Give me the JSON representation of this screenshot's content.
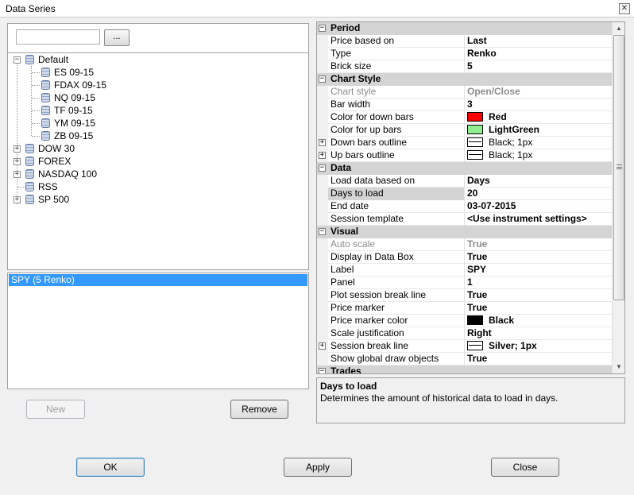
{
  "window": {
    "title": "Data Series",
    "close_glyph": "✕"
  },
  "instrument_search": {
    "value": "",
    "placeholder": "",
    "browse_label": "..."
  },
  "tree": [
    {
      "label": "Default",
      "expanded": true,
      "children": [
        "ES 09-15",
        "FDAX 09-15",
        "NQ 09-15",
        "TF 09-15",
        "YM 09-15",
        "ZB 09-15"
      ]
    },
    {
      "label": "DOW 30",
      "expanded": false
    },
    {
      "label": "FOREX",
      "expanded": false
    },
    {
      "label": "NASDAQ 100",
      "expanded": false
    },
    {
      "label": "RSS",
      "expanded": null
    },
    {
      "label": "SP 500",
      "expanded": false
    }
  ],
  "series_list": {
    "items": [
      "SPY (5 Renko)"
    ]
  },
  "buttons": {
    "new": "New",
    "remove": "Remove",
    "ok": "OK",
    "apply": "Apply",
    "close": "Close"
  },
  "properties": {
    "period": {
      "category": "Period",
      "rows": [
        {
          "name": "Price based on",
          "value": "Last"
        },
        {
          "name": "Type",
          "value": "Renko"
        },
        {
          "name": "Brick size",
          "value": "5"
        }
      ]
    },
    "chart_style": {
      "category": "Chart Style",
      "rows": [
        {
          "name": "Chart style",
          "value": "Open/Close",
          "readonly": true
        },
        {
          "name": "Bar width",
          "value": "3"
        },
        {
          "name": "Color for down bars",
          "value": "Red",
          "swatch": "#ff0000"
        },
        {
          "name": "Color for up bars",
          "value": "LightGreen",
          "swatch": "#90ee90"
        },
        {
          "name": "Down bars outline",
          "value": "Black; 1px",
          "outline": true
        },
        {
          "name": "Up bars outline",
          "value": "Black; 1px",
          "outline": true
        }
      ]
    },
    "data": {
      "category": "Data",
      "rows": [
        {
          "name": "Load data based on",
          "value": "Days"
        },
        {
          "name": "Days to load",
          "value": "20",
          "selected": true
        },
        {
          "name": "End date",
          "value": "03-07-2015"
        },
        {
          "name": "Session template",
          "value": "<Use instrument settings>"
        }
      ]
    },
    "visual": {
      "category": "Visual",
      "rows": [
        {
          "name": "Auto scale",
          "value": "True",
          "readonly": true
        },
        {
          "name": "Display in Data Box",
          "value": "True"
        },
        {
          "name": "Label",
          "value": "SPY"
        },
        {
          "name": "Panel",
          "value": "1"
        },
        {
          "name": "Plot session break line",
          "value": "True"
        },
        {
          "name": "Price marker",
          "value": "True"
        },
        {
          "name": "Price marker color",
          "value": "Black",
          "swatch": "#000000"
        },
        {
          "name": "Scale justification",
          "value": "Right"
        },
        {
          "name": "Session break line",
          "value": "Silver; 1px",
          "outline": true
        },
        {
          "name": "Show global draw objects",
          "value": "True"
        }
      ]
    },
    "trades": {
      "category": "Trades"
    }
  },
  "help": {
    "title": "Days to load",
    "description": "Determines the amount of historical data to load in days."
  }
}
